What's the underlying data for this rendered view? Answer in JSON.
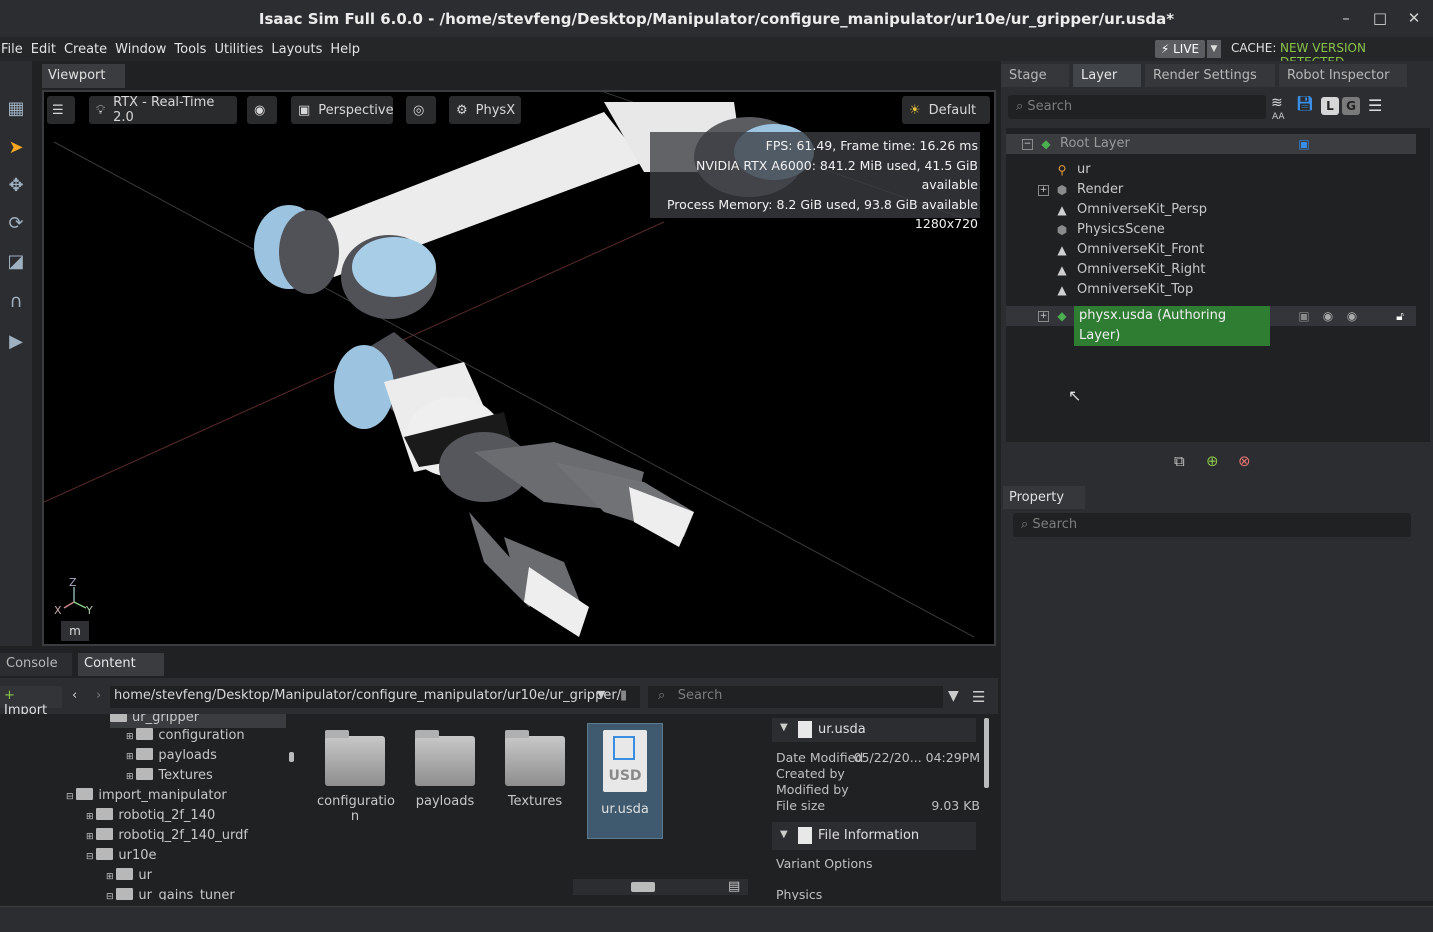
{
  "window": {
    "title": "Isaac Sim Full 6.0.0 - /home/stevfeng/Desktop/Manipulator/configure_manipulator/ur10e/ur_gripper/ur.usda*",
    "minimize": "–",
    "maximize": "□",
    "close": "✕"
  },
  "menu": [
    "File",
    "Edit",
    "Create",
    "Window",
    "Tools",
    "Utilities",
    "Layouts",
    "Help"
  ],
  "status": {
    "live": "⚡ LIVE",
    "cache_label": "CACHE:",
    "cache_value": "NEW VERSION DETECTED",
    "accent": "#8bc34a"
  },
  "viewport": {
    "tab": "Viewport",
    "renderer": "RTX - Real-Time 2.0",
    "camera": "Perspective",
    "physx": "PhysX",
    "lighting": "Default",
    "stats": [
      "FPS: 61.49, Frame time: 16.26 ms",
      "NVIDIA RTX A6000: 841.2 MiB used, 41.5 GiB available",
      "Process Memory: 8.2 GiB used, 93.8 GiB available",
      "1280x720"
    ],
    "axis": {
      "z": "Z",
      "x": "X",
      "y": "Y"
    },
    "units": "m"
  },
  "right_tabs": [
    "Stage",
    "Layer",
    "Render Settings",
    "Robot Inspector"
  ],
  "layer": {
    "search_placeholder": "Search",
    "aa_label": "AA",
    "l_btn": "L",
    "g_btn": "G",
    "root": "Root Layer",
    "children": [
      "ur",
      "Render",
      "OmniverseKit_Persp",
      "PhysicsScene",
      "OmniverseKit_Front",
      "OmniverseKit_Right",
      "OmniverseKit_Top"
    ],
    "authoring": "physx.usda (Authoring Layer)"
  },
  "property": {
    "tab": "Property",
    "search_placeholder": "Search"
  },
  "bottom_tabs": [
    "Console",
    "Content"
  ],
  "content": {
    "import_label": "Import",
    "path": "home/stevfeng/Desktop/Manipulator/configure_manipulator/ur10e/ur_gripper/",
    "search_placeholder": "Search",
    "tree": [
      {
        "label": "ur_gripper",
        "depth": 2,
        "open": true
      },
      {
        "label": "configuration",
        "depth": 3
      },
      {
        "label": "payloads",
        "depth": 3
      },
      {
        "label": "Textures",
        "depth": 3
      },
      {
        "label": "import_manipulator",
        "depth": 1,
        "open": true
      },
      {
        "label": "robotiq_2f_140",
        "depth": 2
      },
      {
        "label": "robotiq_2f_140_urdf",
        "depth": 2
      },
      {
        "label": "ur10e",
        "depth": 2,
        "open": true
      },
      {
        "label": "ur",
        "depth": 3
      },
      {
        "label": "ur_gains_tuner",
        "depth": 3,
        "open": true
      }
    ],
    "files": [
      {
        "label": "configuratio n"
      },
      {
        "label": "payloads"
      },
      {
        "label": "Textures"
      },
      {
        "label": "ur.usda",
        "usd": "USD"
      }
    ],
    "info": {
      "file": "ur.usda",
      "date_modified_label": "Date Modified",
      "date_modified": "05/22/20... 04:29PM",
      "created_by_label": "Created by",
      "modified_by_label": "Modified by",
      "file_size_label": "File size",
      "file_size": "9.03 KB",
      "file_info": "File Information",
      "variant": "Variant Options",
      "physics": "Physics"
    }
  }
}
